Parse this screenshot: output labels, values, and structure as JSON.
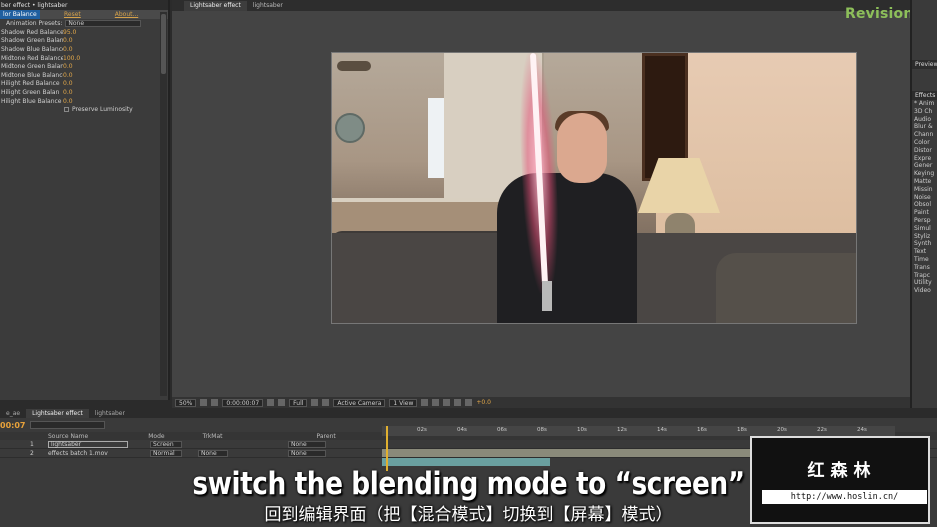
{
  "effect_controls": {
    "header": "ber effect • lightsaber",
    "effect_name": "lor Balance",
    "reset_label": "Reset",
    "about_label": "About...",
    "preset_label": "Animation Presets:",
    "preset_value": "None",
    "params": [
      {
        "label": "Shadow Red Balance",
        "value": "95.0"
      },
      {
        "label": "Shadow Green Balan",
        "value": "0.0"
      },
      {
        "label": "Shadow Blue Balance",
        "value": "0.0"
      },
      {
        "label": "Midtone Red Balance",
        "value": "100.0"
      },
      {
        "label": "Midtone Green Balan",
        "value": "0.0"
      },
      {
        "label": "Midtone Blue Balance",
        "value": "0.0"
      },
      {
        "label": "Hilight Red Balance",
        "value": "0.0"
      },
      {
        "label": "Hilight Green Balan",
        "value": "0.0"
      },
      {
        "label": "Hilight Blue Balance",
        "value": "0.0"
      }
    ],
    "preserve_label": "Preserve Luminosity"
  },
  "comp_viewer": {
    "tabs": [
      "Lightsaber effect",
      "lightsaber"
    ],
    "zoom": "50%",
    "timecode": "0:00:00:07",
    "resolution": "Full",
    "camera": "Active Camera",
    "views": "1 View",
    "exposure": "+0.0"
  },
  "logo": {
    "text": "Revision",
    "x": "X"
  },
  "right_panel": {
    "preview_label": "Preview",
    "effects_label": "Effects",
    "items": [
      "* Anim",
      "3D Ch",
      "Audio",
      "Blur &",
      "Chann",
      "Color",
      "Distor",
      "Expre",
      "Gener",
      "Keying",
      "Matte",
      "Missin",
      "Noise",
      "Obsol",
      "Paint",
      "Persp",
      "Simul",
      "Styliz",
      "Synth",
      "Text",
      "Time",
      "Trans",
      "Trapc",
      "Utility",
      "Video"
    ]
  },
  "timeline": {
    "tabs": [
      "e_ae",
      "Lightsaber effect",
      "lightsaber"
    ],
    "timecode": "00:07",
    "columns": {
      "source": "Source Name",
      "mode": "Mode",
      "trkmat": "TrkMat",
      "parent": "Parent"
    },
    "layers": [
      {
        "num": "1",
        "name": "lightsaber",
        "mode": "Screen",
        "trkmat": "",
        "parent": "None"
      },
      {
        "num": "2",
        "name": "effects batch 1.mov",
        "mode": "Normal",
        "trkmat": "None",
        "parent": "None"
      }
    ],
    "ruler": [
      "02s",
      "04s",
      "06s",
      "08s",
      "10s",
      "12s",
      "14s",
      "16s",
      "18s",
      "20s",
      "22s",
      "24s"
    ]
  },
  "watermark": {
    "title": "红森林",
    "url": "http://www.hoslin.cn/"
  },
  "subtitles": {
    "en": "switch the blending mode to “screen”",
    "zh": "回到编辑界面（把【混合模式】切换到【屏幕】模式）"
  }
}
